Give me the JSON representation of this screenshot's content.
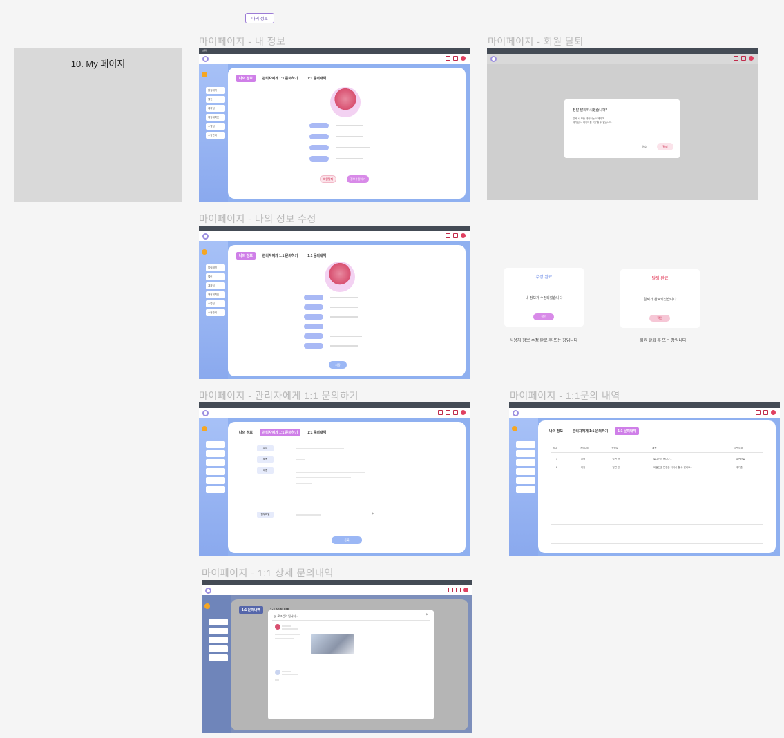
{
  "top_tag": "나의 정보",
  "section_title": "10. My 페이지",
  "frames": {
    "my_info": {
      "label": "마이페이지 - 내 정보",
      "window_title": "브랜",
      "tabs": [
        "나의 정보",
        "관리자에게 1:1 문의하기",
        "1:1 문의내역"
      ],
      "sidebar_menu": [
        "알림내역",
        "캘린",
        "계획팀",
        "재정계획표",
        "수업팀",
        "수정관리"
      ],
      "buttons": {
        "cancel": "회원탈퇴",
        "edit": "정보수정하기"
      }
    },
    "withdraw": {
      "label": "마이페이지 - 회원 탈퇴",
      "modal_title": "정말 탈퇴하시겠습니까?",
      "modal_body": [
        "탈퇴 시 모든 데이터는 삭제되며",
        "재가입 시 데이터를 복구할 수 없습니다."
      ],
      "cancel": "취소",
      "confirm": "탈퇴"
    },
    "edit_info": {
      "label": "마이페이지 - 나의 정보 수정",
      "tabs": [
        "나의 정보",
        "관리자에게 1:1 문의하기",
        "1:1 문의내역"
      ],
      "save": "저장"
    },
    "alerts": [
      {
        "title": "수정 완료",
        "message": "내 정보가 수정되었습니다",
        "button": "확인",
        "caption": "사용자 정보 수정 완료 후 뜨는 창입니다"
      },
      {
        "title": "탈퇴 완료",
        "message": "탈퇴가 완료되었습니다",
        "button": "확인",
        "caption": "회원 탈퇴 후 뜨는 창입니다"
      }
    ],
    "inquiry": {
      "label": "마이페이지 - 관리자에게 1:1 문의하기",
      "tabs": [
        "나의 정보",
        "관리자에게 1:1 문의하기",
        "1:1 문의내역"
      ],
      "field_labels": [
        "분류",
        "제목",
        "내용",
        "첨부파일"
      ],
      "submit": "등록"
    },
    "history": {
      "label": "마이페이지 - 1:1문의 내역",
      "tabs": [
        "나의 정보",
        "관리자에게 1:1 문의하기",
        "1:1 문의내역"
      ],
      "columns": [
        "NO",
        "카테고리",
        "작성일",
        "제목",
        "답변 여부"
      ],
      "rows": [
        [
          "1",
          "계정",
          "답변 완",
          "로그인이 됩니다...",
          "답변완료"
        ],
        [
          "2",
          "계정",
          "답변 완",
          "비밀번호 변경은 어디서 할 수 있나요...",
          "대기중"
        ]
      ]
    },
    "detail": {
      "label": "마이페이지 - 1:1 상세 문의내역",
      "tabs": [
        "1:1 문의내역",
        "1:1 문의내역"
      ],
      "modal_title": "Q. 로그인이 됩니다..."
    }
  }
}
